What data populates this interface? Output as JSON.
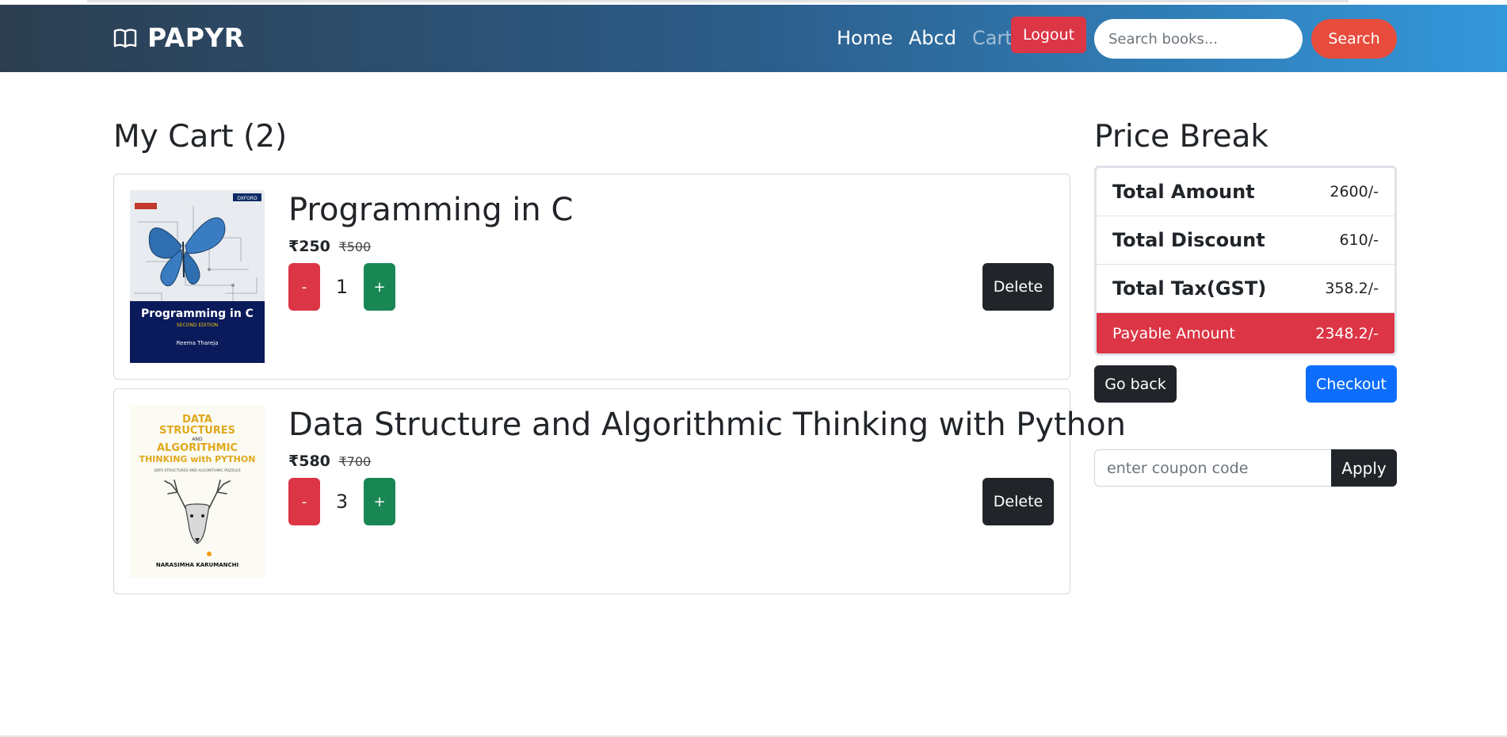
{
  "navbar": {
    "brand": "PAPYR",
    "links": [
      "Home",
      "Abcd",
      "Cart"
    ],
    "logout_label": "Logout",
    "search_placeholder": "Search books...",
    "search_label": "Search"
  },
  "cart": {
    "title": "My Cart (2)",
    "items": [
      {
        "title": "Programming in C",
        "price": "₹250",
        "old_price": "₹500",
        "quantity": "1",
        "minus_label": "-",
        "plus_label": "+",
        "delete_label": "Delete",
        "cover": {
          "title": "Programming in C",
          "edition": "SECOND EDITION",
          "author": "Reema Thareja",
          "publisher": "OXFORD"
        }
      },
      {
        "title": "Data Structure and Algorithmic Thinking with Python",
        "price": "₹580",
        "old_price": "₹700",
        "quantity": "3",
        "minus_label": "-",
        "plus_label": "+",
        "delete_label": "Delete",
        "cover": {
          "line1": "DATA",
          "line2": "STRUCTURES",
          "line3": "AND",
          "line4": "ALGORITHMIC",
          "line5": "THINKING with PYTHON",
          "subtitle": "DATA STRUCTURES AND ALGORITHMIC PUZZLES",
          "author": "NARASIMHA KARUMANCHI"
        }
      }
    ]
  },
  "price_break": {
    "title": "Price Break",
    "rows": [
      {
        "label": "Total Amount",
        "value": "2600/-"
      },
      {
        "label": "Total Discount",
        "value": "610/-"
      },
      {
        "label": "Total Tax(GST)",
        "value": "358.2/-"
      }
    ],
    "payable": {
      "label": "Payable Amount",
      "value": "2348.2/-"
    },
    "go_back_label": "Go back",
    "checkout_label": "Checkout",
    "coupon_placeholder": "enter coupon code",
    "apply_label": "Apply"
  }
}
